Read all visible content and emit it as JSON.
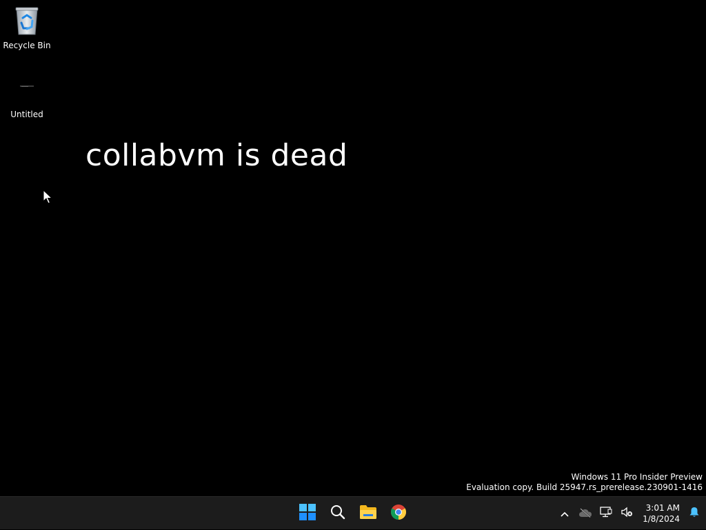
{
  "desktop": {
    "wallpaper_text": "collabvm is dead",
    "icons": [
      {
        "label": "Recycle Bin",
        "icon": "recycle-bin-icon"
      },
      {
        "label": "Untitled",
        "icon": "file-thumbnail-icon"
      }
    ]
  },
  "watermark": {
    "line1": "Windows 11 Pro Insider Preview",
    "line2": "Evaluation copy. Build 25947.rs_prerelease.230901-1416"
  },
  "taskbar": {
    "apps": [
      {
        "name": "Start",
        "icon": "windows-start-icon"
      },
      {
        "name": "Search",
        "icon": "search-icon"
      },
      {
        "name": "File Explorer",
        "icon": "folder-icon"
      },
      {
        "name": "Google Chrome",
        "icon": "chrome-icon"
      }
    ],
    "tray": {
      "icons": [
        "chevron-up-icon",
        "onedrive-offline-icon",
        "network-icon",
        "volume-muted-icon"
      ],
      "time": "3:01 AM",
      "date": "1/8/2024",
      "notification_icon": "bell-icon"
    }
  },
  "colors": {
    "background": "#000000",
    "taskbar": "#1c1c1c",
    "accent": "#0078d4"
  }
}
